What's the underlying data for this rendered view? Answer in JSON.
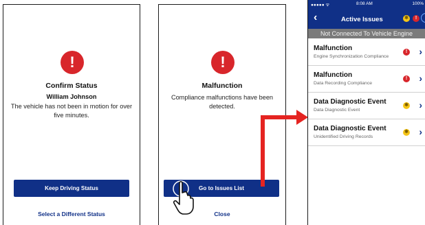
{
  "confirm_screen": {
    "icon": "alert-icon",
    "title": "Confirm Status",
    "driver_name": "William Johnson",
    "message": "The vehicle has not been in motion for over five minutes.",
    "primary_button": "Keep Driving Status",
    "secondary_button": "Select a Different Status"
  },
  "malfunction_screen": {
    "icon": "alert-icon",
    "title": "Malfunction",
    "message": "Compliance malfunctions have been detected.",
    "primary_button": "Go to Issues List",
    "secondary_button": "Close"
  },
  "issues_screen": {
    "status_bar": {
      "signal": "●●●●● ᯤ",
      "time": "8:08 AM",
      "battery": "100%"
    },
    "title": "Active Issues",
    "banner": "Not Connected To Vehicle Engine",
    "issues": [
      {
        "title": "Malfunction",
        "subtitle": "Engine Synchronization Compliance",
        "severity": "red"
      },
      {
        "title": "Malfunction",
        "subtitle": "Data Recording Compliance",
        "severity": "red"
      },
      {
        "title": "Data Diagnostic Event",
        "subtitle": "Data Diagnostic Event",
        "severity": "yellow"
      },
      {
        "title": "Data Diagnostic Event",
        "subtitle": "Unidentified Driving Records",
        "severity": "yellow"
      }
    ]
  },
  "colors": {
    "brand_blue": "#103087",
    "alert_red": "#d8262b",
    "warning_yellow": "#f5c518",
    "arrow_red": "#e52421"
  }
}
